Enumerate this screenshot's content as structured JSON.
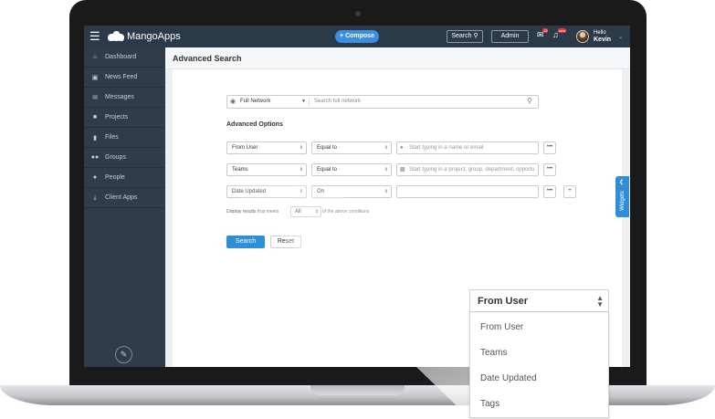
{
  "topbar": {
    "menu_icon": "hamburger-icon",
    "logo_text": "MangoApps",
    "compose_label": "+ Compose",
    "search_label": "Search",
    "admin_label": "Admin",
    "notifications": [
      {
        "icon": "chat-bubble-icon",
        "badge": "13"
      },
      {
        "icon": "megaphone-icon",
        "badge": "new"
      }
    ],
    "user_greeting": "Hello",
    "user_name": "Kevin"
  },
  "sidebar": {
    "items": [
      {
        "icon": "home-icon",
        "label": "Dashboard"
      },
      {
        "icon": "inbox-icon",
        "label": "News Feed"
      },
      {
        "icon": "envelope-icon",
        "label": "Messages"
      },
      {
        "icon": "briefcase-icon",
        "label": "Projects"
      },
      {
        "icon": "file-icon",
        "label": "Files"
      },
      {
        "icon": "group-icon",
        "label": "Groups"
      },
      {
        "icon": "person-icon",
        "label": "People"
      },
      {
        "icon": "download-icon",
        "label": "Client Apps"
      }
    ],
    "footer_icon": "pencil-icon"
  },
  "page": {
    "title": "Advanced Search"
  },
  "search_scope": {
    "selected": "Full Network",
    "placeholder": "Search full network"
  },
  "advanced": {
    "title": "Advanced Options",
    "rows": [
      {
        "field": "From User",
        "operator": "Equal to",
        "placeholder": "Start typing in a name or email",
        "value_icon": "person-icon"
      },
      {
        "field": "Teams",
        "operator": "Equal to",
        "placeholder": "Start typing in a project, group, department, opportu",
        "value_icon": "team-icon"
      },
      {
        "field": "Date Updated",
        "operator": "On",
        "placeholder": "",
        "value_icon": ""
      }
    ],
    "more_label": "•••",
    "add_label": "+",
    "meets_prefix": "Display results that meets",
    "meets_value": "All",
    "meets_suffix": "of the above conditions",
    "search_button": "Search",
    "reset_button": "Reset"
  },
  "widgets_tab": "Widgets",
  "dropdown": {
    "selected": "From User",
    "options": [
      "From User",
      "Teams",
      "Date Updated",
      "Tags"
    ]
  },
  "colors": {
    "topbar": "#2b3a48",
    "sidebar": "#2f3c4a",
    "accent": "#2e8fd6",
    "compose": "#3c8fe0"
  }
}
